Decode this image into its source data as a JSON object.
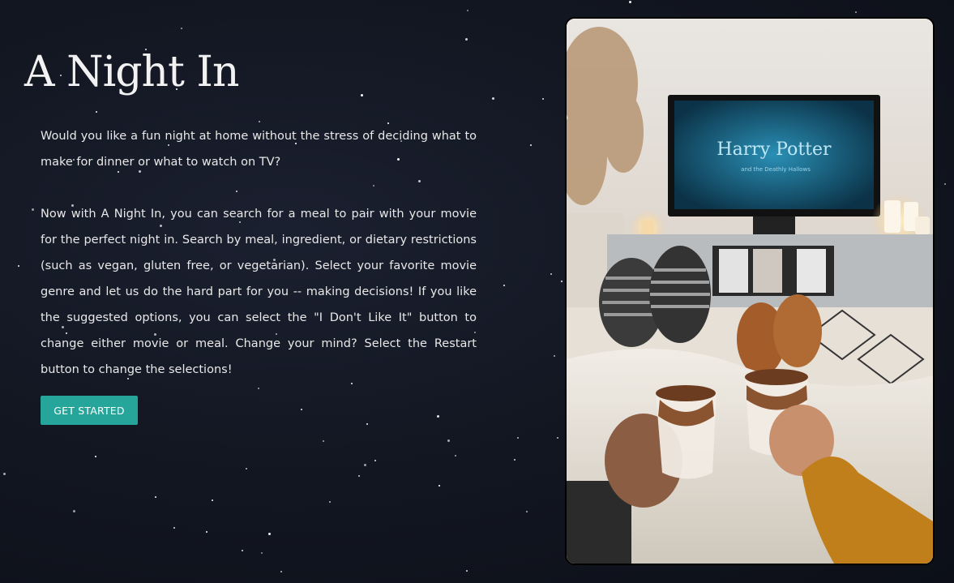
{
  "page": {
    "title": "A Night In",
    "intro_paragraph_1": "Would you like a fun night at home without the stress of deciding what to make for dinner or what to watch on TV?",
    "intro_paragraph_2": "Now with A Night In, you can search for a meal to pair with your movie for the perfect night in. Search by meal, ingredient, or dietary restrictions (such as vegan, gluten free, or vegetarian). Select your favorite movie genre and let us do the hard part for you -- making decisions! If you like the suggested options, you can select the \"I Don't Like It\" button to change either movie or meal. Change your mind? Select the Restart button to change the selections!",
    "cta_label": "Get Started"
  },
  "hero_image": {
    "tv_title_line1": "Harry Potter",
    "tv_title_line2": "and the Deathly Hallows"
  },
  "colors": {
    "background": "#131722",
    "accent_button": "#26a69a",
    "text": "#e8e8e8"
  }
}
